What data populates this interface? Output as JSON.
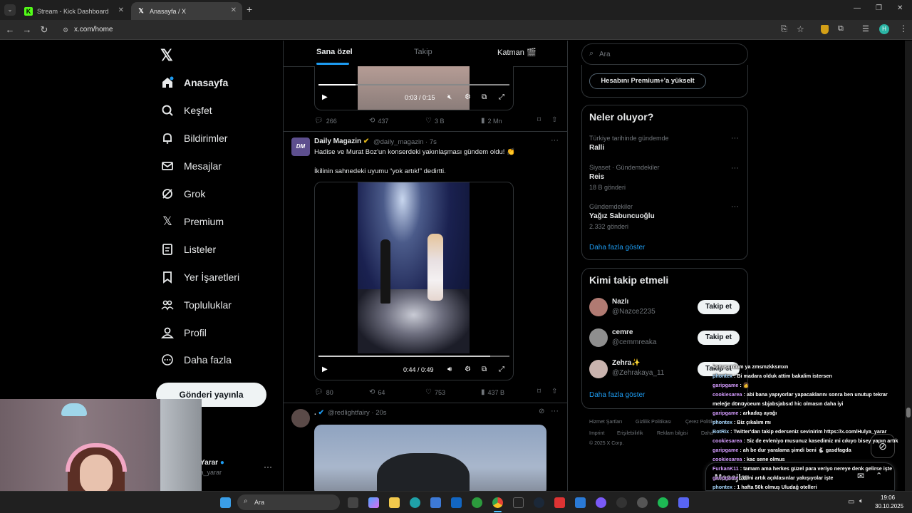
{
  "browser": {
    "tabs": [
      {
        "title": "Stream - Kick Dashboard",
        "icon": "kick-icon",
        "active": false
      },
      {
        "title": "Anasayfa / X",
        "icon": "x-logo-icon",
        "active": true
      }
    ],
    "url": "x.com/home"
  },
  "sidebar": {
    "items": [
      {
        "label": "Anasayfa",
        "icon": "home-icon"
      },
      {
        "label": "Keşfet",
        "icon": "search-icon"
      },
      {
        "label": "Bildirimler",
        "icon": "bell-icon"
      },
      {
        "label": "Mesajlar",
        "icon": "mail-icon"
      },
      {
        "label": "Grok",
        "icon": "grok-icon"
      },
      {
        "label": "Premium",
        "icon": "x-logo-icon"
      },
      {
        "label": "Listeler",
        "icon": "list-icon"
      },
      {
        "label": "Yer İşaretleri",
        "icon": "bookmark-icon"
      },
      {
        "label": "Topluluklar",
        "icon": "people-icon"
      },
      {
        "label": "Profil",
        "icon": "person-icon"
      },
      {
        "label": "Daha fazla",
        "icon": "more-circle-icon"
      }
    ],
    "post_button": "Gönderi yayınla",
    "account": {
      "name": "ra Yarar",
      "handle": "ulya_yarar"
    }
  },
  "feed": {
    "tabs": [
      "Sana özel",
      "Takip",
      "Katman 🎬"
    ],
    "post1": {
      "video_time": "0:03 / 0:15",
      "replies": "266",
      "reposts": "437",
      "likes": "3 B",
      "views": "2 Mn"
    },
    "post2": {
      "author": "Daily Magazin",
      "handle": "@daily_magazin",
      "time": "· 7s",
      "text1": "Hadise ve Murat Boz'un konserdeki yakınlaşması gündem oldu! 👏",
      "text2": "İkilinin sahnedeki uyumu “yok artık!” dedirtti.",
      "video_time": "0:44 / 0:49",
      "video_progress": 0.9,
      "replies": "80",
      "reposts": "64",
      "likes": "753",
      "views": "437 B"
    },
    "post3": {
      "author": ".",
      "handle": "@redlightfairy",
      "time": "· 20s"
    }
  },
  "right": {
    "search_placeholder": "Ara",
    "premium_button": "Hesabını Premium+'a yükselt",
    "trends_title": "Neler oluyor?",
    "trends": [
      {
        "category": "Türkiye tarihinde gündemde",
        "name": "Ralli",
        "count": ""
      },
      {
        "category": "Siyaset · Gündemdekiler",
        "name": "Reis",
        "count": "18 B gönderi"
      },
      {
        "category": "Gündemdekiler",
        "name": "Yağız Sabuncuoğlu",
        "count": "2.332 gönderi"
      }
    ],
    "trends_more": "Daha fazla göster",
    "who_title": "Kimi takip etmeli",
    "who": [
      {
        "name": "Nazlı",
        "handle": "@Nazce2235",
        "button": "Takip et"
      },
      {
        "name": "cemre",
        "handle": "@cemmreaka",
        "button": "Takip et"
      },
      {
        "name": "Zehra✨",
        "handle": "@Zehrakaya_11",
        "button": "Takip et"
      }
    ],
    "who_more": "Daha fazla göster",
    "footer": [
      "Hizmet Şartları",
      "Gizlilik Politikası",
      "Çerez Politikası",
      "Imprint",
      "Erişilebilirlik",
      "Reklam bilgisi",
      "Daha",
      "© 2025 X Corp."
    ]
  },
  "chat": [
    {
      "user": "",
      "msg": "konuşurdum ya zmsmzkksmxn"
    },
    {
      "user": "phontex",
      "msg": " : Bi madara olduk attim bakalim istersen"
    },
    {
      "user": "garipgame",
      "msg": " : 👩"
    },
    {
      "user": "cookiesarea",
      "msg": " : abi bana yapıyorlar yapacaklarını sonra ben unutup tekrar"
    },
    {
      "user": "",
      "msg": "meleğe dönüyoeum sbjabsjabsıd hic olmasın daha iyi"
    },
    {
      "user": "garipgame",
      "msg": " : arkadaş ayağı"
    },
    {
      "user": "phontex",
      "msg": " : Biz çıkalım mı"
    },
    {
      "user": "BotRix",
      "msg": " : Twitter'dan takip ederseniz sevinirim https://x.com/Hulya_yarar"
    },
    {
      "user": "cookiesarea",
      "msg": " : Siz de evleniyo musunuz kasedimiz mi cıkıyo bisey yapın artık"
    },
    {
      "user": "garipgame",
      "msg": " : ah be dur yaralama şimdi beni  🐇 gasdfagda"
    },
    {
      "user": "cookiesarea",
      "msg": " : kac sene olmus"
    },
    {
      "user": "FurkanK11",
      "msg": " : tamam ama herkes güzel para veriyo nereye denk gelirse işte"
    },
    {
      "user": "garipgame",
      "msg": " : dimi artık açıklasınlar yakışıyolar işte"
    },
    {
      "user": "phontex",
      "msg": " : 1 hafta 50k olmuş Uludağ otelleri"
    },
    {
      "user": "cookiesarea",
      "msg": " : aynen öyle"
    }
  ],
  "messages_dock": "Mesajlar",
  "taskbar": {
    "search": "Ara",
    "time": "19:06",
    "date": "30.10.2025"
  },
  "colors": {
    "accent": "#1d9bf0",
    "verified": "#e2b719",
    "bg": "#000000",
    "border": "#2f3336"
  }
}
